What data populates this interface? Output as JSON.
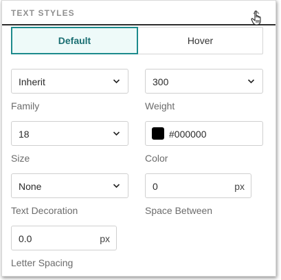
{
  "header": {
    "title": "TEXT STYLES"
  },
  "tabs": [
    {
      "label": "Default",
      "active": true
    },
    {
      "label": "Hover",
      "active": false
    }
  ],
  "fields": {
    "family": {
      "value": "Inherit",
      "label": "Family"
    },
    "weight": {
      "value": "300",
      "label": "Weight"
    },
    "size": {
      "value": "18",
      "label": "Size"
    },
    "color": {
      "value": "#000000",
      "label": "Color",
      "swatch": "#000000"
    },
    "decoration": {
      "value": "None",
      "label": "Text Decoration"
    },
    "space_between": {
      "value": "0",
      "unit": "px",
      "label": "Space Between"
    },
    "letter_spacing": {
      "value": "0.0",
      "unit": "px",
      "label": "Letter Spacing"
    }
  },
  "colors": {
    "accent": "#1c8a8c",
    "active_tab_bg": "#eefaf9"
  },
  "icons": {
    "collapse": "chevron-up-icon",
    "cursor": "hand-pointer-icon",
    "dropdown": "chevron-down-icon"
  }
}
